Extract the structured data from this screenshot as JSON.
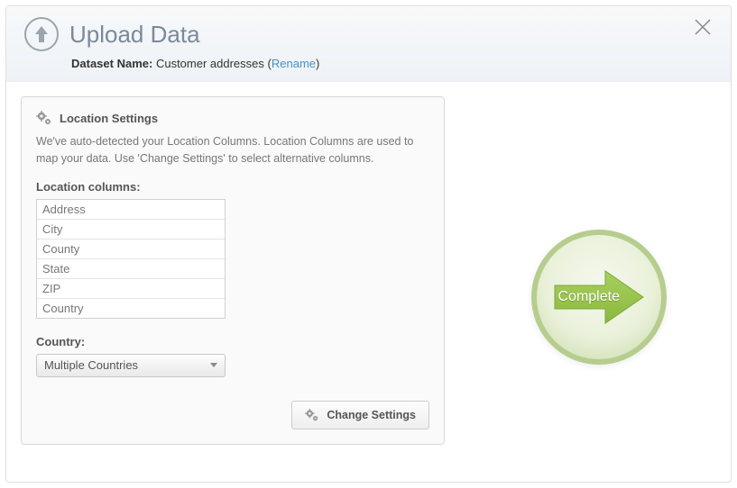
{
  "header": {
    "title": "Upload Data",
    "dataset_label": "Dataset Name:",
    "dataset_value": "Customer addresses",
    "rename_text": "Rename"
  },
  "panel": {
    "title": "Location Settings",
    "description": "We've auto-detected your Location Columns. Location Columns are used to map your data. Use 'Change Settings' to select alternative columns.",
    "columns_label": "Location columns:",
    "columns": [
      "Address",
      "City",
      "County",
      "State",
      "ZIP",
      "Country"
    ],
    "country_label": "Country:",
    "country_selected": "Multiple Countries",
    "change_settings_label": "Change Settings"
  },
  "complete_button": {
    "label": "Complete"
  }
}
